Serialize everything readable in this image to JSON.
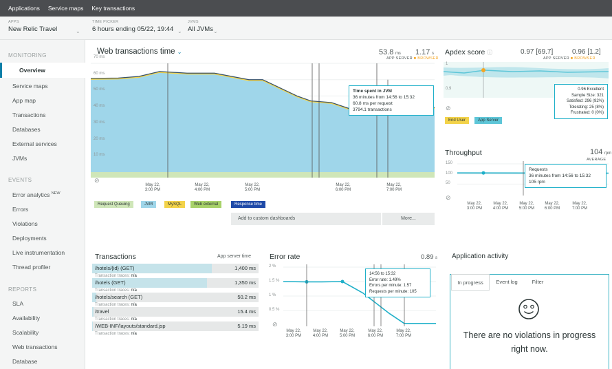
{
  "topnav": {
    "items": [
      "Applications",
      "Service maps",
      "Key transactions"
    ]
  },
  "pickers": {
    "apps": {
      "label": "APPS",
      "value": "New Relic Travel"
    },
    "time": {
      "label": "TIME PICKER",
      "value": "6 hours ending 05/22, 19:44"
    },
    "jvms": {
      "label": "JVMS",
      "value": "All JVMs"
    }
  },
  "sidebar": {
    "monitoring_title": "MONITORING",
    "monitoring": [
      "Overview",
      "Service maps",
      "App map",
      "Transactions",
      "Databases",
      "External services",
      "JVMs"
    ],
    "events_title": "EVENTS",
    "error_analytics": "Error analytics",
    "new_badge": "NEW",
    "events": [
      "Errors",
      "Violations",
      "Deployments",
      "Live instrumentation",
      "Thread profiler"
    ],
    "reports_title": "REPORTS",
    "reports": [
      "SLA",
      "Availability",
      "Scalability",
      "Web transactions",
      "Database"
    ]
  },
  "web_tx": {
    "title": "Web transactions time",
    "app_server_value": "53.8",
    "app_server_unit": "ms",
    "browser_value": "1.17",
    "browser_unit": "s",
    "app_server_label": "APP SERVER",
    "browser_label": "BROWSER",
    "y_ticks": [
      "70 ms",
      "60 ms",
      "50 ms",
      "40 ms",
      "30 ms",
      "20 ms",
      "10 ms"
    ],
    "x_ticks": [
      "May 22,\n3:00 PM",
      "May 22,\n4:00 PM",
      "May 22,\n5:00 PM",
      "May 22,\n6:00 PM",
      "May 22,\n7:00 PM"
    ],
    "tooltip": {
      "title": "Time spent in JVM",
      "line1": "36 minutes from 14:56 to 15:32",
      "line2": "60.8 ms per request",
      "line3": "3794.1 transactions"
    },
    "legend": [
      "Request Queuing",
      "JVM",
      "MySQL",
      "Web external",
      "Response time"
    ],
    "add_dashboards": "Add to custom dashboards",
    "more": "More..."
  },
  "apdex": {
    "title": "Apdex score",
    "app_score": "0.97 [69.7]",
    "browser_score": "0.96 [1.2]",
    "app_label": "APP SERVER",
    "browser_label": "BROWSER",
    "y_ticks": [
      "1",
      "0.9"
    ],
    "tooltip": [
      "0.96 Excellent",
      "Sample Size: 321",
      "Satisfied: 296 (92%)",
      "Tolerating: 25 (8%)",
      "Frustrated: 0 (0%)"
    ],
    "legend": [
      "End User",
      "App Server"
    ]
  },
  "throughput": {
    "title": "Throughput",
    "value": "104",
    "unit": "rpm",
    "avg_label": "AVERAGE",
    "y_ticks": [
      "150",
      "100",
      "50"
    ],
    "x_ticks": [
      "May 22,\n3:00 PM",
      "May 22,\n4:00 PM",
      "May 22,\n5:00 PM",
      "May 22,\n6:00 PM",
      "May 22,\n7:00 PM"
    ],
    "tooltip": [
      "Requests",
      "36 minutes from 14:56 to 15:32",
      "105 rpm"
    ]
  },
  "transactions": {
    "title": "Transactions",
    "col_label": "App server time",
    "rows": [
      {
        "name": "/hotels/{id} (GET)",
        "value": "1,400 ms",
        "traces": "Transaction traces:",
        "traces_val": "n/a"
      },
      {
        "name": "/hotels (GET)",
        "value": "1,350 ms",
        "traces": "Transaction traces:",
        "traces_val": "n/a"
      },
      {
        "name": "/hotels/search (GET)",
        "value": "50.2 ms",
        "traces": "Transaction traces:",
        "traces_val": "n/a"
      },
      {
        "name": "/travel",
        "value": "15.4 ms",
        "traces": "Transaction traces:",
        "traces_val": "n/a"
      },
      {
        "name": "/WEB-INF/layouts/standard.jsp",
        "value": "5.19 ms",
        "traces": "Transaction traces:",
        "traces_val": "n/a"
      }
    ],
    "bar_fractions": [
      1.0,
      0.96,
      0.036,
      0.011,
      0.004
    ]
  },
  "error_rate": {
    "title": "Error rate",
    "value": "0.89",
    "unit": "s",
    "y_ticks": [
      "2 %",
      "1.5 %",
      "1 %",
      "0.5 %"
    ],
    "x_ticks": [
      "May 22,\n3:00 PM",
      "May 22,\n4:00 PM",
      "May 22,\n5:00 PM",
      "May 22,\n6:00 PM",
      "May 22,\n7:00 PM"
    ],
    "tooltip": [
      "14:56 to 15:32",
      "Error rate: 1.49%",
      "Errors per minute: 1.57",
      "Requests per minute: 105"
    ]
  },
  "activity": {
    "title": "Application activity",
    "tabs": [
      "In progress",
      "Event log",
      "Filter"
    ],
    "empty_line1": "There are no violations in progress",
    "empty_line2": "right now."
  },
  "colors": {
    "jvm": "#9fd6ea",
    "mysql": "#f3d34a",
    "web_external": "#a8d26a",
    "request_queuing": "#cfe6b8",
    "response_time": "#1f4aa8",
    "accent": "#1fb0c9",
    "browser": "#f5a623"
  }
}
